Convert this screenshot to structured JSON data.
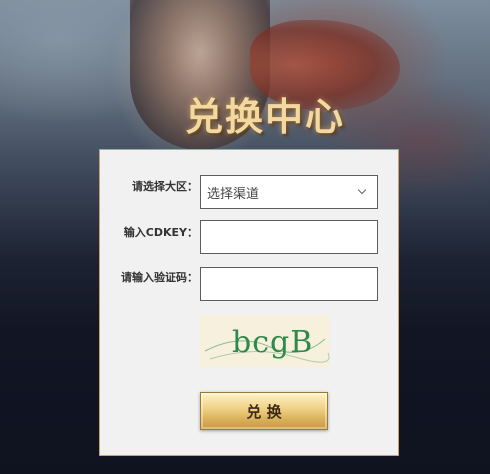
{
  "header": {
    "title": "兑换中心"
  },
  "form": {
    "channel_label": "请选择大区：",
    "channel_selected": "选择渠道",
    "cdkey_label": "输入CDKEY：",
    "cdkey_value": "",
    "captcha_label": "请输入验证码：",
    "captcha_value": "",
    "captcha_image_text": "bcgB",
    "submit_label": "兑 换"
  },
  "colors": {
    "accent_gold": "#f1d48a",
    "title_gold": "#f3d8a0",
    "captcha_green": "#2e8a4a",
    "panel_bg": "#f1f1f1"
  },
  "icons": {
    "select_chevron": "chevron-down-icon"
  }
}
